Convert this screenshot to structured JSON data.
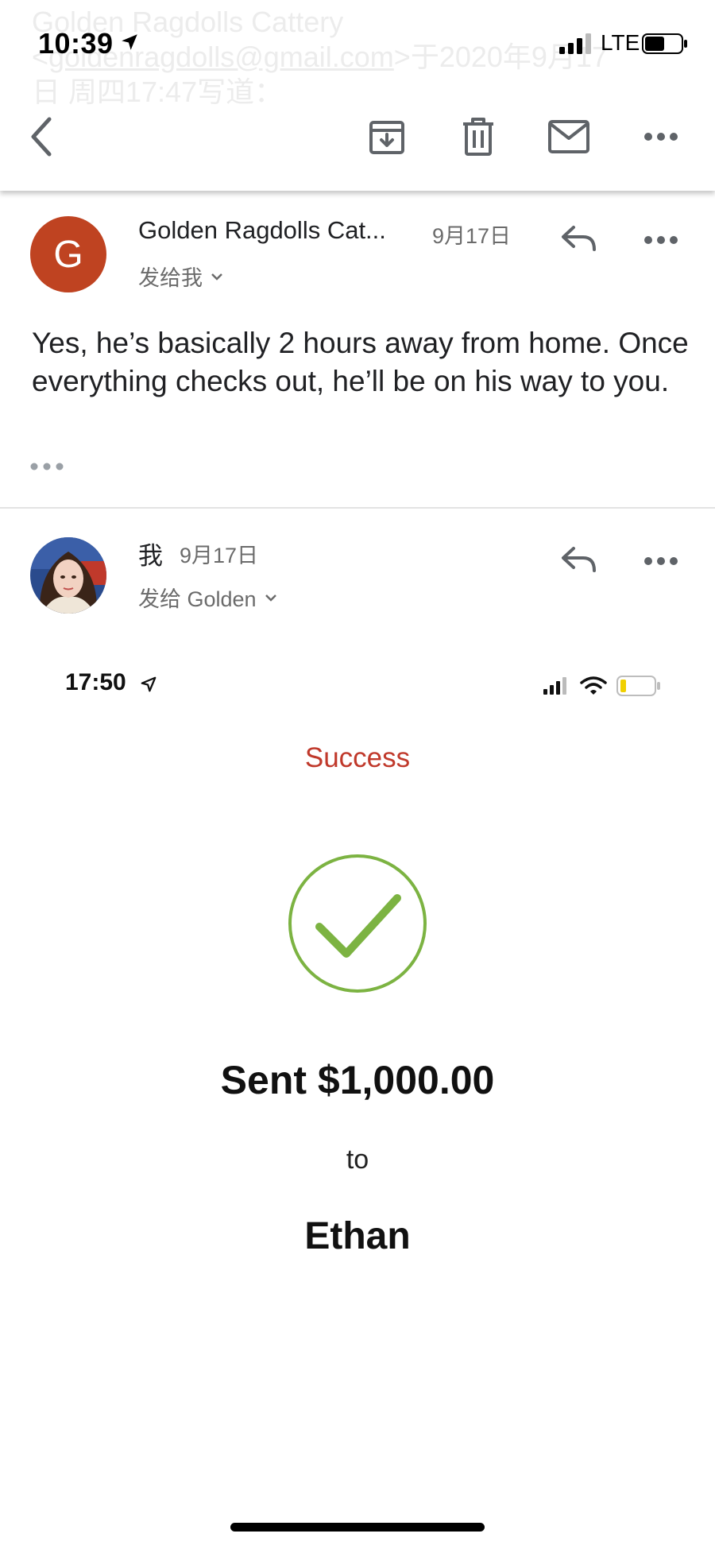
{
  "status_bar": {
    "time": "10:39",
    "network": "LTE"
  },
  "quoted_header": {
    "line1": "Golden Ragdolls Cattery",
    "link": "goldenragdolls@gmail.com",
    "line2_suffix": ">于2020年9月17",
    "line3": "日 周四17:47写道："
  },
  "toolbar": {
    "back": "chevron-left-icon",
    "archive": "archive-icon",
    "delete": "trash-icon",
    "mark_unread": "mail-icon",
    "more": "more-horizontal-icon"
  },
  "messages": [
    {
      "avatar_letter": "G",
      "avatar_color": "#bf4321",
      "sender": "Golden Ragdolls Cat...",
      "date": "9月17日",
      "recipient": "发给我",
      "body": "Yes, he’s basically 2 hours away from home. Once everything checks out, he’ll be on his way to you."
    },
    {
      "sender": "我",
      "date": "9月17日",
      "recipient": "发给 Golden"
    }
  ],
  "attachment": {
    "time": "17:50",
    "status": "Success",
    "status_color": "#c0392b",
    "check_color": "#7cb342",
    "amount": "Sent $1,000.00",
    "to": "to",
    "recipient_name": "Ethan"
  }
}
